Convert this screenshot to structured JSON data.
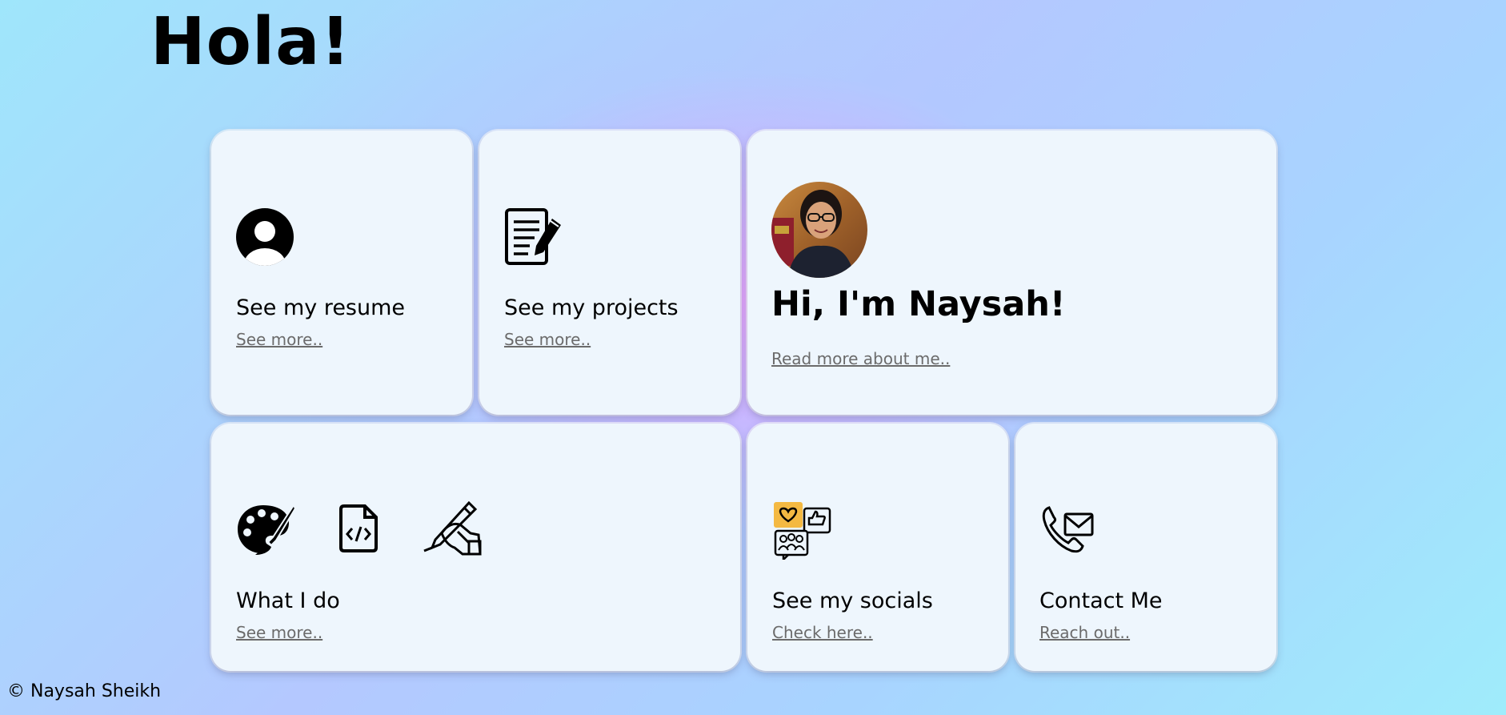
{
  "header": {
    "title": "Hola!"
  },
  "cards": {
    "resume": {
      "icon": "user-avatar-icon",
      "title": "See my resume",
      "link": "See more.."
    },
    "projects": {
      "icon": "document-edit-icon",
      "title": "See my projects",
      "link": "See more.."
    },
    "about": {
      "photo": "profile-photo",
      "title": "Hi, I'm Naysah!",
      "link": "Read more about me.."
    },
    "what_i_do": {
      "icons": [
        "palette-icon",
        "code-file-icon",
        "hand-writing-icon"
      ],
      "title": "What I do",
      "link": "See more.."
    },
    "socials": {
      "icon": "social-media-icon",
      "title": "See my socials",
      "link": "Check here.."
    },
    "contact": {
      "icon": "phone-mail-icon",
      "title": "Contact Me",
      "link": "Reach out.."
    }
  },
  "footer": {
    "copyright": "© Naysah Sheikh"
  },
  "colors": {
    "card_bg": "#eef6fd",
    "link": "#6b6b6b",
    "social_accent": "#f4b942"
  }
}
